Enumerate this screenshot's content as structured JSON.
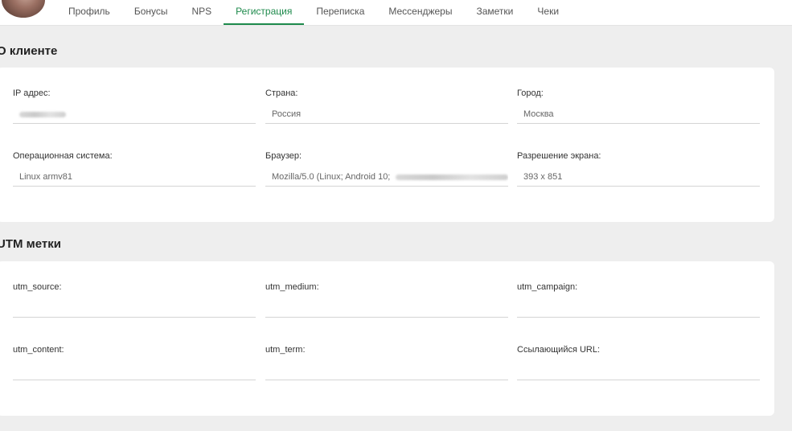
{
  "tabs": [
    {
      "label": "Профиль"
    },
    {
      "label": "Бонусы"
    },
    {
      "label": "NPS"
    },
    {
      "label": "Регистрация",
      "active": true
    },
    {
      "label": "Переписка"
    },
    {
      "label": "Мессенджеры"
    },
    {
      "label": "Заметки"
    },
    {
      "label": "Чеки"
    }
  ],
  "client_section": {
    "title": "О клиенте",
    "ip_label": "IP адрес:",
    "country_label": "Страна:",
    "country_value": "Россия",
    "city_label": "Город:",
    "city_value": "Москва",
    "os_label": "Операционная система:",
    "os_value": "Linux armv81",
    "browser_label": "Браузер:",
    "browser_value": "Mozilla/5.0 (Linux; Android 10;",
    "resolution_label": "Разрешение экрана:",
    "resolution_value": "393 x 851"
  },
  "utm_section": {
    "title": "UTM метки",
    "source_label": "utm_source:",
    "medium_label": "utm_medium:",
    "campaign_label": "utm_campaign:",
    "content_label": "utm_content:",
    "term_label": "utm_term:",
    "referrer_label": "Ссылающийся URL:"
  },
  "colors": {
    "accent": "#1e8a4c",
    "background": "#eeeeee",
    "card": "#ffffff"
  }
}
